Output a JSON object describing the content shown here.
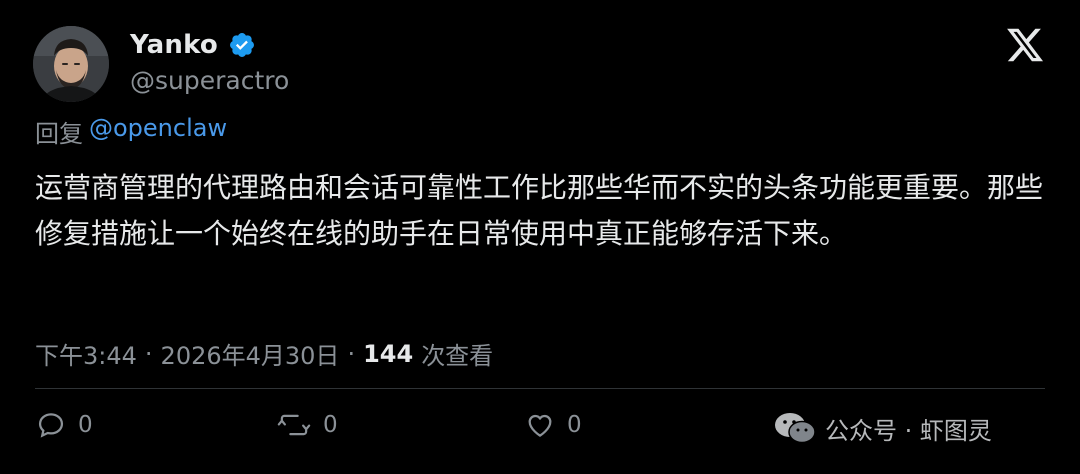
{
  "user": {
    "display_name": "Yanko",
    "handle": "@superactro",
    "verified": true,
    "avatar_icon": "avatar-man-icon"
  },
  "reply": {
    "prefix": "回复",
    "mention": "@openclaw"
  },
  "tweet": {
    "text": "运营商管理的代理路由和会话可靠性工作比那些华而不实的头条功能更重要。那些修复措施让一个始终在线的助手在日常使用中真正能够存活下来。"
  },
  "meta": {
    "time": "下午3:44",
    "separator": "·",
    "date": "2026年4月30日",
    "views_count": "144",
    "views_label": "次查看"
  },
  "actions": {
    "reply_count": "0",
    "retweet_count": "0",
    "like_count": "0"
  },
  "watermark": {
    "text": "公众号 · 虾图灵"
  },
  "colors": {
    "background": "#000000",
    "text": "#e7e9ea",
    "secondary": "#8b9197",
    "link": "#4a99e9",
    "verified": "#1d9bf0"
  }
}
